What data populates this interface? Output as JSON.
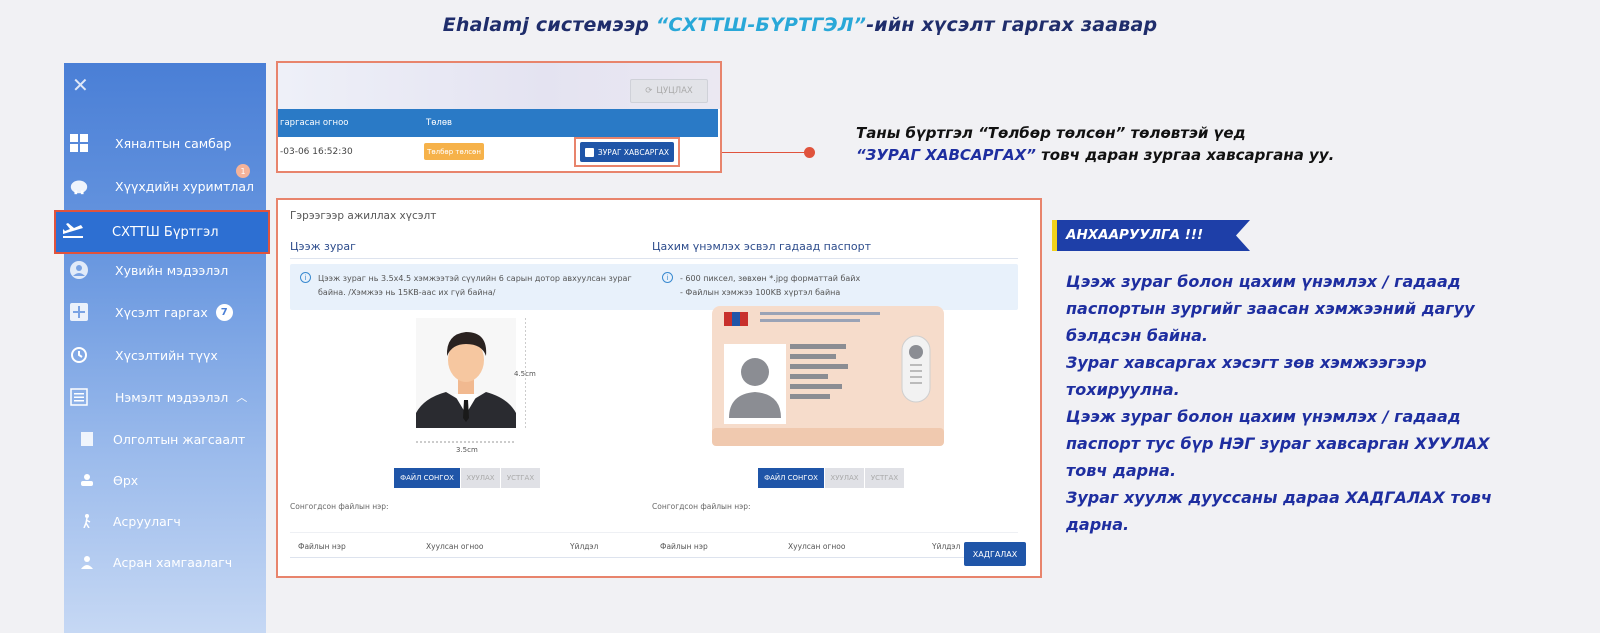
{
  "title": {
    "prefix": "Ehalamj системээр ",
    "highlight": "“СХТТШ-БҮРТГЭЛ”",
    "suffix": "-ийн хүсэлт гаргах заавар"
  },
  "sidebar": {
    "items": [
      {
        "label": "Хяналтын самбар"
      },
      {
        "label": "Хүүхдийн хуримтлал",
        "badge": "1"
      },
      {
        "label": "СХТТШ Бүртгэл"
      },
      {
        "label": "Хувийн мэдээлэл"
      },
      {
        "label": "Хүсэлт гаргах",
        "badge": "7"
      },
      {
        "label": "Хүсэлтийн түүх"
      },
      {
        "label": "Нэмэлт мэдээлэл"
      },
      {
        "label": "Олголтын жагсаалт"
      },
      {
        "label": "Өрх"
      },
      {
        "label": "Асруулагч"
      },
      {
        "label": "Асран хамгаалагч"
      }
    ]
  },
  "top_shot": {
    "cancel_label": "ЦУЦЛАХ",
    "col_date": "гаргасан огноо",
    "col_status": "Төлөв",
    "row_date": "-03-06 16:52:30",
    "status_badge": "Төлбөр төлсөн",
    "attach_button": "ЗУРАГ ХАВСАРГАХ"
  },
  "note_top": {
    "line1": "Таны бүртгэл “Төлбөр төлсөн” төлөвтэй үед",
    "line2_hl": "“ЗУРАГ ХАВСАРГАХ”",
    "line2_rest": " товч даран зургаа хавсаргана уу."
  },
  "main_shot": {
    "title": "Гэрээгээр ажиллах хүсэлт",
    "left": {
      "heading": "Цээж зураг",
      "info1": "Цээж зураг нь 3.5x4.5 хэмжээтэй сүүлийн 6 сарын дотор авхуулсан зураг",
      "info2": "байна. /Хэмжээ нь 15KB-аас их гүй байна/",
      "dim_h": "4.5cm",
      "dim_w": "3.5cm"
    },
    "right": {
      "heading": "Цахим үнэмлэх эсвэл гадаад паспорт",
      "info1": "- 600 пиксел, зөвхөн *.jpg форматтай байх",
      "info2": "- Файлын хэмжээ 100KB хүртэл байна"
    },
    "btn_choose": "ФАЙЛ СОНГОХ",
    "btn_upload": "ХУУЛАХ",
    "btn_delete": "УСТГАХ",
    "selected_label": "Сонгогдсон файлын нэр:",
    "col_name": "Файлын нэр",
    "col_date": "Хуулсан огноо",
    "col_action": "Үйлдэл",
    "save": "ХАДГАЛАХ"
  },
  "warning": {
    "banner": "АНХААРУУЛГА !!!",
    "lines": [
      "Цээж зураг болон цахим үнэмлэх / гадаад",
      "паспортын зургийг заасан хэмжээний дагуу",
      "бэлдсэн байна.",
      "Зураг хавсаргах хэсэгт зөв хэмжээгээр",
      "тохируулна.",
      "Цээж зураг болон цахим үнэмлэх / гадаад",
      "паспорт тус бүр НЭГ зураг хавсарган ХУУЛАХ",
      "товч дарна.",
      "Зураг хуулж дууссаны дараа ХАДГАЛАХ товч",
      "дарна."
    ]
  },
  "colors": {
    "title_navy": "#1f2d6b",
    "title_highlight": "#29a8d8",
    "note_blue": "#1e2ea0",
    "accent_red": "#e0533c",
    "button_blue": "#1f55a8",
    "banner_blue": "#1e3fa8",
    "banner_yellow": "#f2d21a"
  }
}
